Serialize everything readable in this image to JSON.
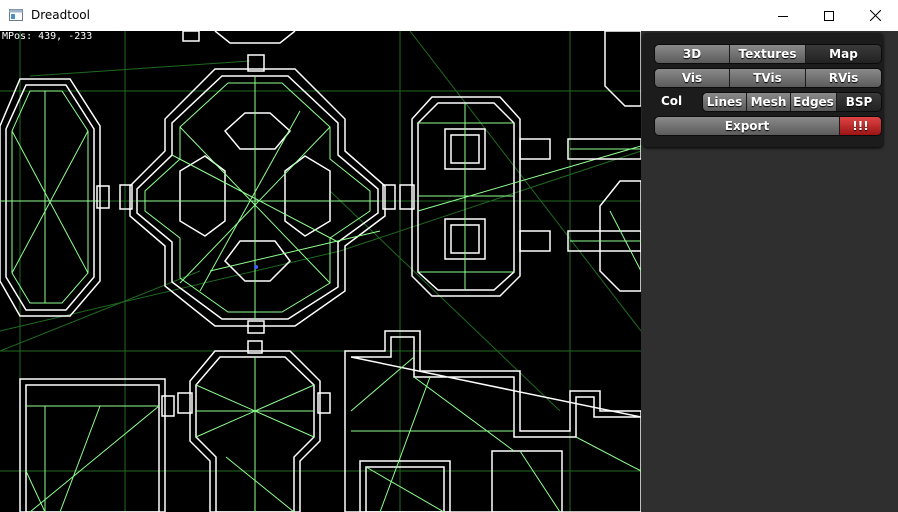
{
  "window": {
    "title": "Dreadtool",
    "minimize_icon": "minimize-icon",
    "maximize_icon": "maximize-icon",
    "close_icon": "close-icon"
  },
  "viewport": {
    "mouse_pos": "MPos: 439, -233"
  },
  "panel": {
    "row1": [
      "3D",
      "Textures",
      "Map"
    ],
    "row2": [
      "Vis",
      "TVis",
      "RVis"
    ],
    "col_label": "Col",
    "row3": [
      "Lines",
      "Mesh",
      "Edges",
      "BSP"
    ],
    "export_label": "Export",
    "danger_label": "!!!"
  },
  "colors": {
    "wire": "#8fff8f",
    "wire_dim": "#1f5f1f",
    "wall": "#ffffff",
    "accent_danger": "#c82020",
    "panel_bg": "#2f2f2f"
  }
}
